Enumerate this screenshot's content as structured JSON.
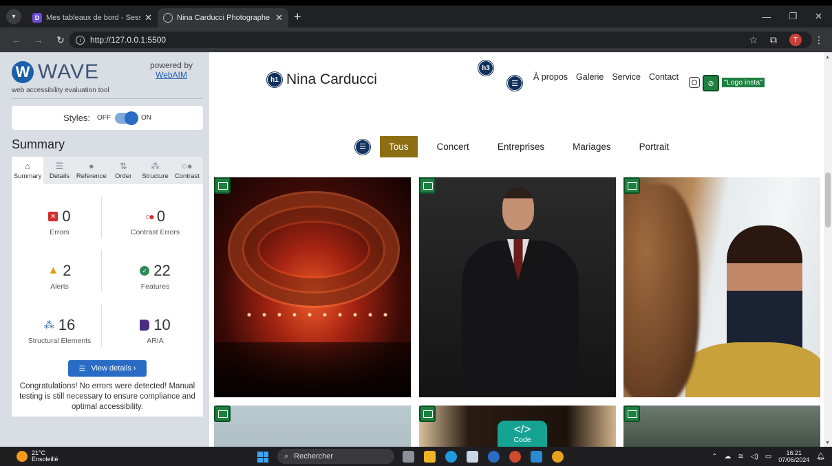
{
  "browser": {
    "tabs": [
      {
        "title": "Mes tableaux de bord - Session",
        "active": false
      },
      {
        "title": "Nina Carducci Photographe à l",
        "active": true
      }
    ],
    "url": "http://127.0.0.1:5500",
    "profile_initial": "T"
  },
  "wave": {
    "brand": "WAVE",
    "tagline": "web accessibility evaluation tool",
    "powered_by": "powered by",
    "powered_link": "WebAIM",
    "styles_label": "Styles:",
    "styles_off": "OFF",
    "styles_on": "ON",
    "summary_title": "Summary",
    "tabs": [
      "Summary",
      "Details",
      "Reference",
      "Order",
      "Structure",
      "Contrast"
    ],
    "stats": {
      "errors": {
        "value": "0",
        "label": "Errors"
      },
      "contrast": {
        "value": "0",
        "label": "Contrast Errors"
      },
      "alerts": {
        "value": "2",
        "label": "Alerts"
      },
      "features": {
        "value": "22",
        "label": "Features"
      },
      "structural": {
        "value": "16",
        "label": "Structural Elements"
      },
      "aria": {
        "value": "10",
        "label": "ARIA"
      }
    },
    "view_details": "View details ›",
    "congrats": "Congratulations! No errors were detected! Manual testing is still necessary to ensure compliance and optimal accessibility."
  },
  "page": {
    "h1_badge": "h1",
    "h3_badge": "h3",
    "title": "Nina Carducci",
    "nav": [
      "À propos",
      "Galerie",
      "Service",
      "Contact"
    ],
    "logo_alt": "\"Logo insta\"",
    "filters": [
      "Tous",
      "Concert",
      "Entreprises",
      "Mariages",
      "Portrait"
    ],
    "code_label": "Code",
    "code_glyph": "</>"
  },
  "taskbar": {
    "temp": "21°C",
    "weather": "Ensoleillé",
    "search": "Rechercher",
    "time": "16:21",
    "date": "07/06/2024"
  },
  "colors": {
    "wave_blue": "#1b5fa8",
    "filter_active": "#8c6f13",
    "wave_green": "#1e8040",
    "badge_navy": "#12305e"
  }
}
